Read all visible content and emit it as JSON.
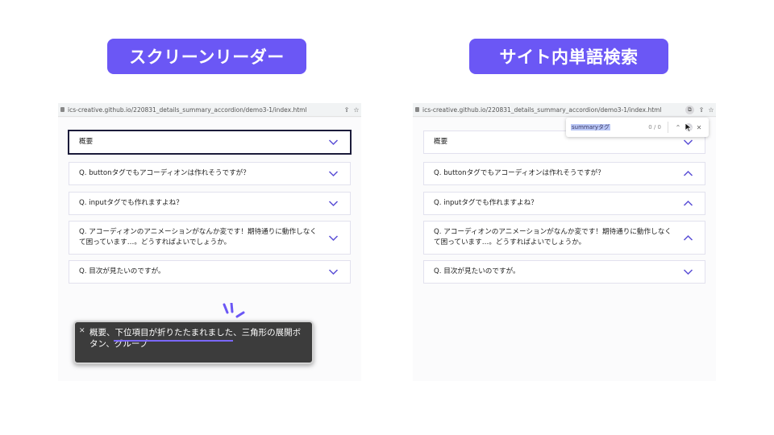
{
  "labels": {
    "left_title": "スクリーンリーダー",
    "right_title": "サイト内単語検索"
  },
  "browser": {
    "url": "ics-creative.github.io/220831_details_summary_accordion/demo3-1/index.html"
  },
  "accordion": {
    "items": [
      "概要",
      "Q. buttonタグでもアコーディオンは作れそうですが？",
      "Q. inputタグでも作れますよね？",
      "Q. アコーディオンのアニメーションがなんか変です！期待通りに動作しなくて困っています…。どうすればよいでしょうか。",
      "Q. 目次が見たいのですが。"
    ]
  },
  "screen_reader": {
    "announcement": "概要、下位項目が折りたたまれました、三角形の展開ボタン、グループ"
  },
  "find_bar": {
    "query": "summaryタグ",
    "count": "0 / 0"
  },
  "icons": {
    "lock": "lock-icon",
    "share": "share-icon",
    "bookmark": "star-icon",
    "chevron": "chevron-icon",
    "close": "close-icon"
  },
  "colors": {
    "accent": "#6b57f5",
    "chevron": "#5b4fd6",
    "sr_box": "#3c3c3c"
  }
}
